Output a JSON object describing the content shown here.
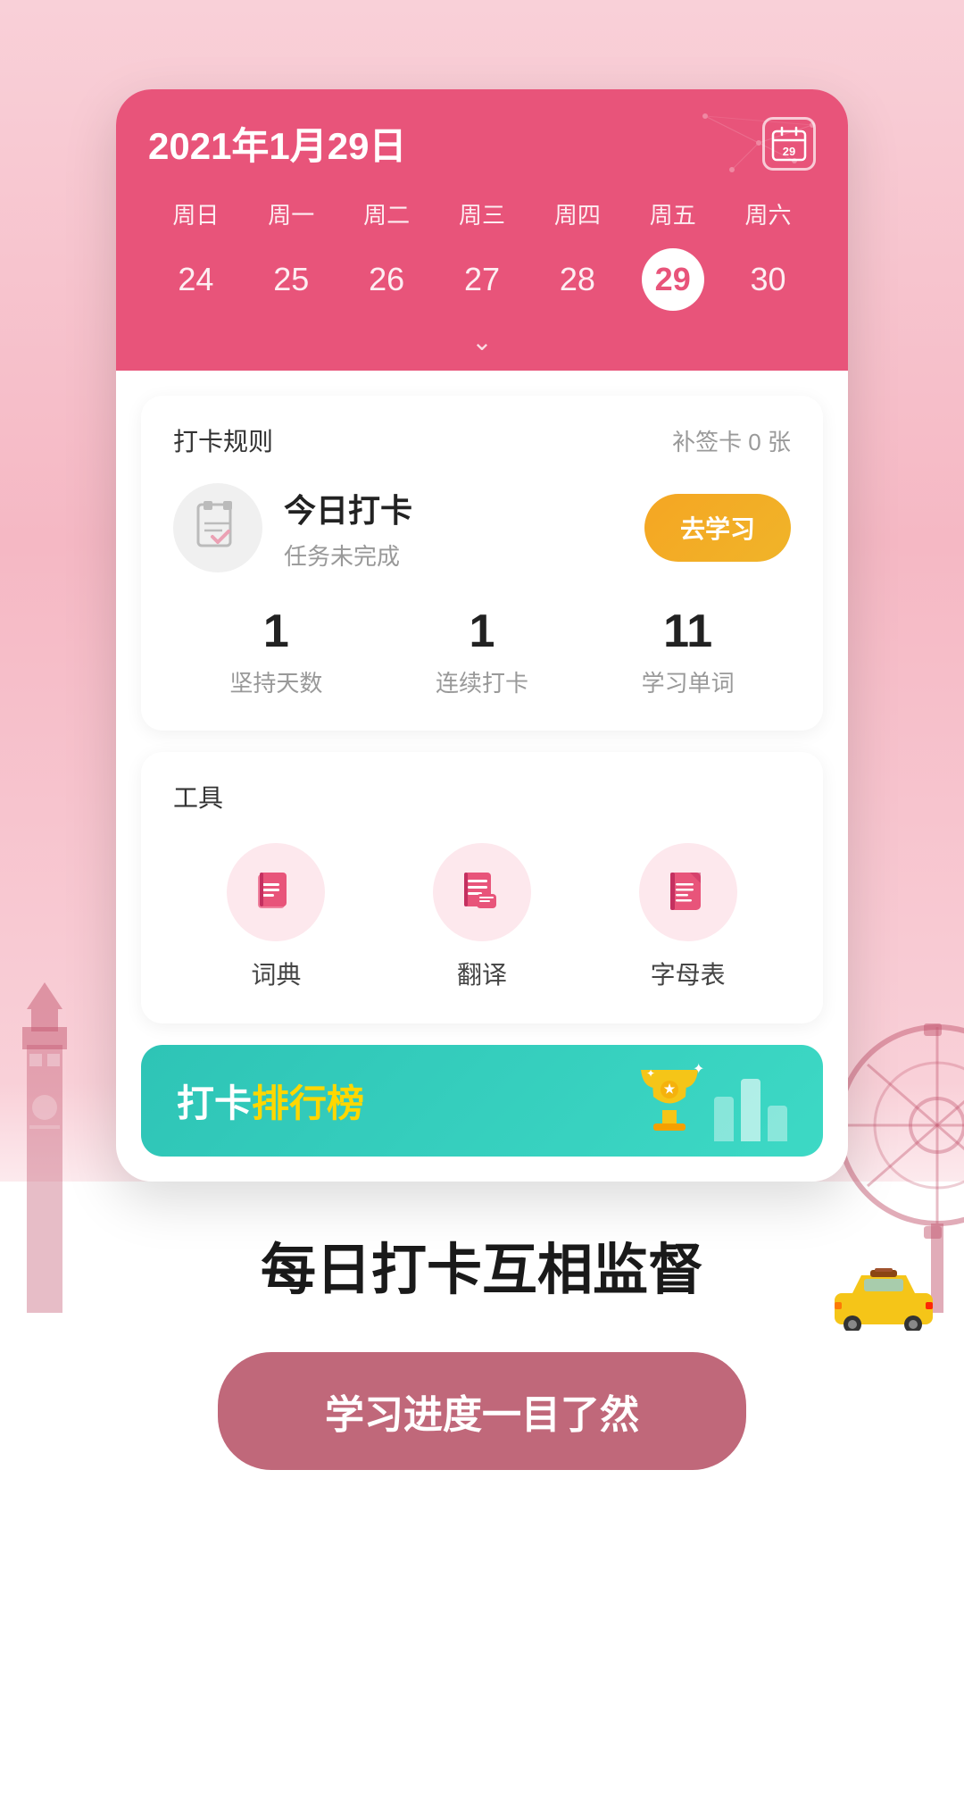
{
  "calendar": {
    "title": "2021年1月29日",
    "icon_label": "29",
    "weekdays": [
      "周日",
      "周一",
      "周二",
      "周三",
      "周四",
      "周五",
      "周六"
    ],
    "dates": [
      "24",
      "25",
      "26",
      "27",
      "28",
      "29",
      "30"
    ],
    "active_date": "29",
    "active_index": 5
  },
  "checkin": {
    "rules_label": "打卡规则",
    "makeup_label": "补签卡 0 张",
    "today_title": "今日打卡",
    "today_subtitle": "任务未完成",
    "study_button": "去学习",
    "stats": [
      {
        "num": "1",
        "label": "坚持天数"
      },
      {
        "num": "1",
        "label": "连续打卡"
      },
      {
        "num": "11",
        "label": "学习单词"
      }
    ]
  },
  "tools": {
    "title": "工具",
    "items": [
      {
        "label": "词典",
        "icon": "📖"
      },
      {
        "label": "翻译",
        "icon": "📝"
      },
      {
        "label": "字母表",
        "icon": "📄"
      }
    ]
  },
  "ranking": {
    "prefix": "打卡",
    "highlight": "排行榜"
  },
  "bottom": {
    "slogan": "每日打卡互相监督",
    "cta": "学习进度一目了然"
  }
}
